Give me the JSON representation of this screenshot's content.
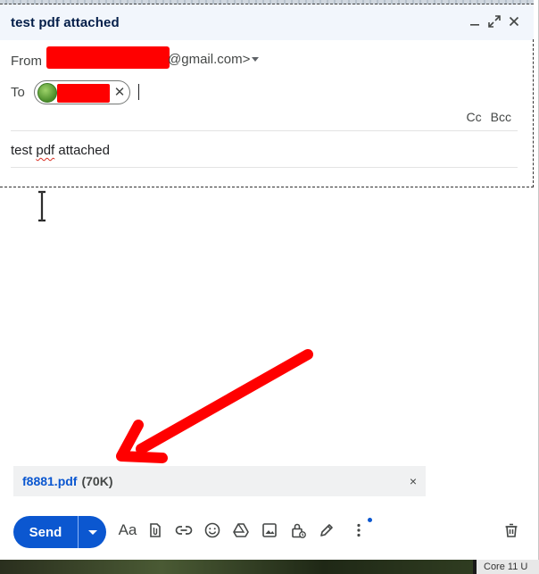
{
  "window": {
    "title": "test pdf attached",
    "controls": [
      "minimize-icon",
      "expand-icon",
      "close-icon"
    ]
  },
  "from": {
    "label": "From",
    "email_suffix": "@gmail.com>"
  },
  "to": {
    "label": "To",
    "recipient_chip_close": "✕"
  },
  "cc_bcc": {
    "cc": "Cc",
    "bcc": "Bcc"
  },
  "subject": {
    "word1": "test",
    "word2": "pdf",
    "word3": "attached"
  },
  "attachment": {
    "filename": "f8881.pdf",
    "size": "(70K)",
    "close": "×"
  },
  "toolbar": {
    "send_label": "Send",
    "format_label": "Aa",
    "icons": [
      "formatting-icon",
      "attach-file-icon",
      "insert-link-icon",
      "emoji-icon",
      "drive-icon",
      "insert-photo-icon",
      "confidential-mode-icon",
      "signature-icon",
      "more-options-icon",
      "discard-icon"
    ]
  },
  "taskbar": {
    "item_label": "Core 11 U"
  },
  "colors": {
    "accent": "#0b57d0",
    "redaction": "#ff0000",
    "annotation_arrow": "#ff0000",
    "titlebar_bg": "#f2f6fc"
  }
}
